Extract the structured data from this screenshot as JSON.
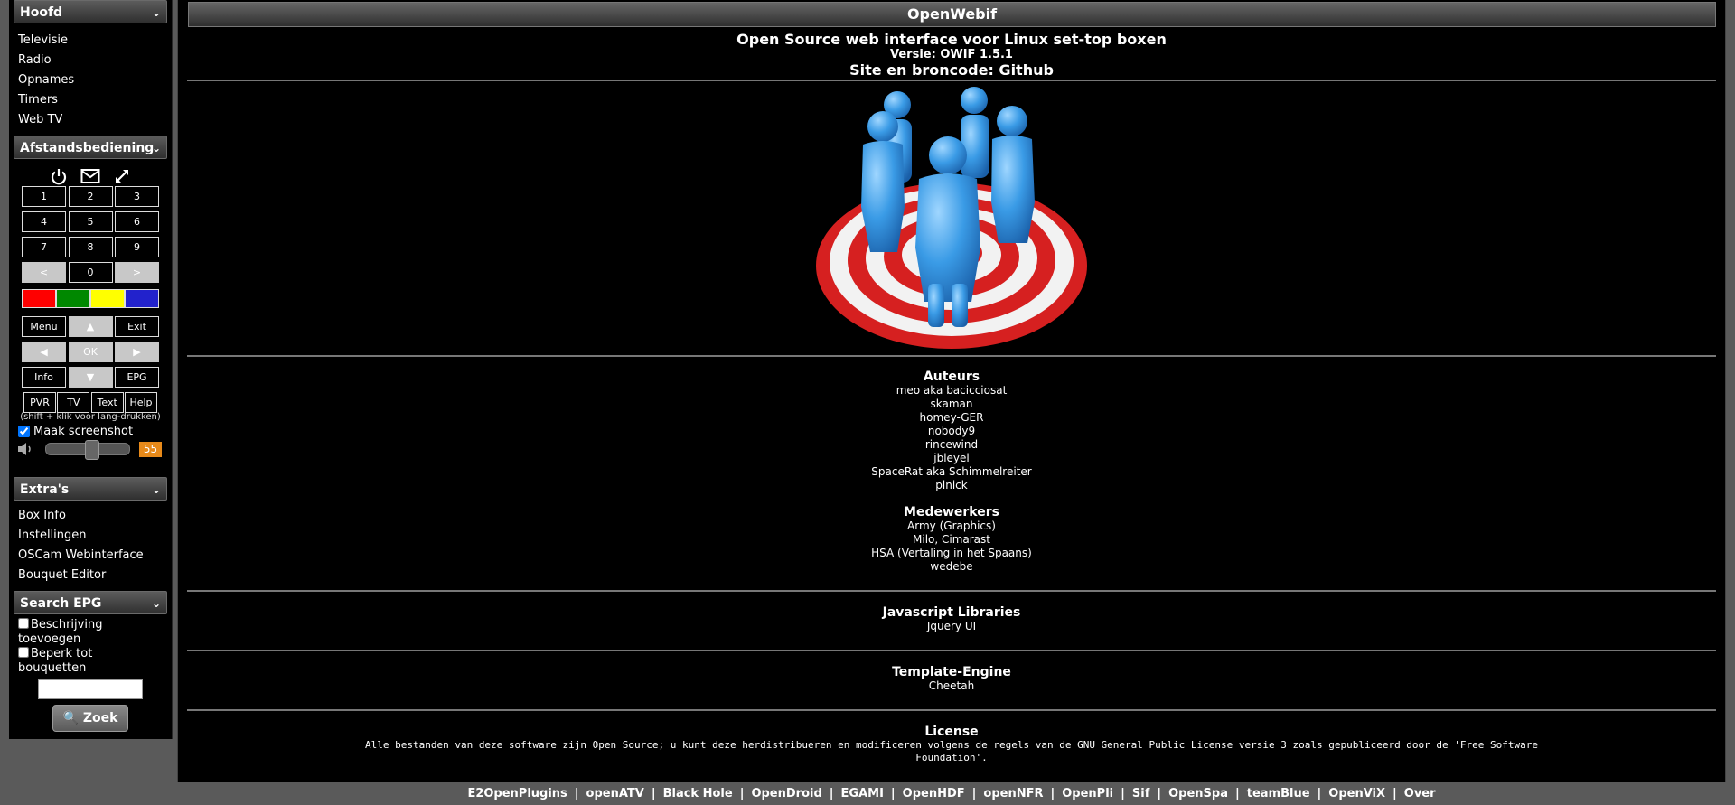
{
  "sidebar": {
    "main_header": "Hoofd",
    "main_items": [
      "Televisie",
      "Radio",
      "Opnames",
      "Timers",
      "Web TV"
    ],
    "remote_header": "Afstandsbediening",
    "remote_icons": [
      "power-icon",
      "envelope-icon",
      "expand-icon"
    ],
    "keypad_rows": [
      [
        "1",
        "2",
        "3"
      ],
      [
        "4",
        "5",
        "6"
      ],
      [
        "7",
        "8",
        "9"
      ],
      [
        "<",
        "0",
        ">"
      ]
    ],
    "color_keys": [
      "#ff0000",
      "#008800",
      "#ffff00",
      "#2222cc"
    ],
    "nav_rows": [
      [
        "Menu",
        "▲",
        "Exit"
      ],
      [
        "◀",
        "OK",
        "▶"
      ],
      [
        "Info",
        "▼",
        "EPG"
      ]
    ],
    "func_keys": [
      "PVR",
      "TV",
      "Text",
      "Help"
    ],
    "hint": "(shift + klik voor lang-drukken)",
    "screenshot_label": "Maak screenshot",
    "screenshot_checked": true,
    "volume": 55,
    "extras_header": "Extra's",
    "extras_items": [
      "Box Info",
      "Instellingen",
      "OSCam Webinterface",
      "Bouquet Editor"
    ],
    "search_header": "Search EPG",
    "search_opt1": "Beschrijving toevoegen",
    "search_opt2": "Beperk tot bouquetten",
    "search_value": "",
    "search_button": "Zoek"
  },
  "main": {
    "title": "OpenWebif",
    "intro": "Open Source web interface voor Linux set-top boxen",
    "version": "Versie: OWIF 1.5.1",
    "site": "Site en broncode: Github",
    "authors_title": "Auteurs",
    "authors": [
      "meo aka bacicciosat",
      "skaman",
      "homey-GER",
      "nobody9",
      "rincewind",
      "jbleyel",
      "SpaceRat aka Schimmelreiter",
      "plnick"
    ],
    "contributors_title": "Medewerkers",
    "contributors": [
      "Army (Graphics)",
      "Milo, Cimarast",
      "HSA (Vertaling in het Spaans)",
      "wedebe"
    ],
    "js_title": "Javascript Libraries",
    "js_value": "Jquery UI",
    "template_title": "Template-Engine",
    "template_value": "Cheetah",
    "license_title": "License",
    "license_text": "Alle bestanden van deze software zijn Open Source; u kunt deze herdistribueren en modificeren volgens de regels van de GNU General Public License versie 3 zoals gepubliceerd door de 'Free Software Foundation'."
  },
  "footer": {
    "links": [
      "E2OpenPlugins",
      "openATV",
      "Black Hole",
      "OpenDroid",
      "EGAMI",
      "OpenHDF",
      "openNFR",
      "OpenPli",
      "Sif",
      "OpenSpa",
      "teamBlue",
      "OpenViX",
      "Over"
    ],
    "separator": "|"
  }
}
